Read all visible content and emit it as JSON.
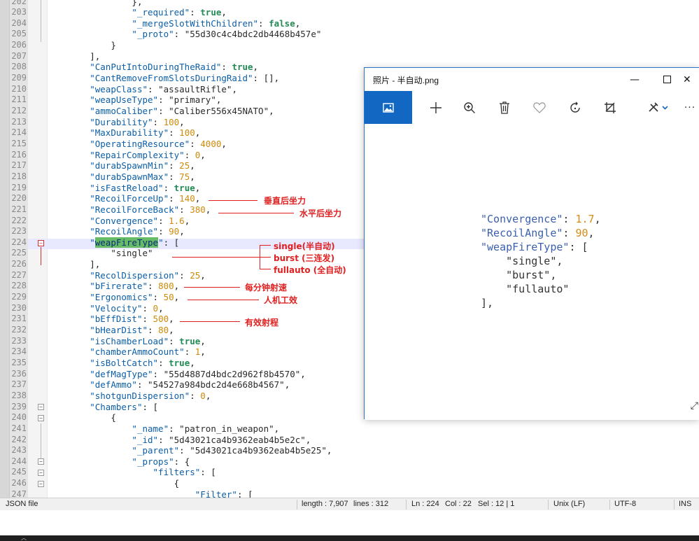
{
  "editor": {
    "lines": [
      {
        "no": "202",
        "html": "                <span class='p'>},</span>"
      },
      {
        "no": "203",
        "html": "                <span class='k'>\"_required\"</span><span class='p'>: </span><span class='b'>true</span><span class='p'>,</span>"
      },
      {
        "no": "204",
        "html": "                <span class='k'>\"_mergeSlotWithChildren\"</span><span class='p'>: </span><span class='b'>false</span><span class='p'>,</span>"
      },
      {
        "no": "205",
        "html": "                <span class='k'>\"_proto\"</span><span class='p'>: </span><span class='s'>\"55d30c4c4bdc2db4468b457e\"</span>"
      },
      {
        "no": "206",
        "html": "            <span class='p'>}</span>"
      },
      {
        "no": "207",
        "html": "        <span class='p'>],</span>"
      },
      {
        "no": "208",
        "html": "        <span class='k'>\"CanPutIntoDuringTheRaid\"</span><span class='p'>: </span><span class='b'>true</span><span class='p'>,</span>"
      },
      {
        "no": "209",
        "html": "        <span class='k'>\"CantRemoveFromSlotsDuringRaid\"</span><span class='p'>: [],</span>"
      },
      {
        "no": "210",
        "html": "        <span class='k'>\"weapClass\"</span><span class='p'>: </span><span class='s'>\"assaultRifle\"</span><span class='p'>,</span>"
      },
      {
        "no": "211",
        "html": "        <span class='k'>\"weapUseType\"</span><span class='p'>: </span><span class='s'>\"primary\"</span><span class='p'>,</span>"
      },
      {
        "no": "212",
        "html": "        <span class='k'>\"ammoCaliber\"</span><span class='p'>: </span><span class='s'>\"Caliber556x45NATO\"</span><span class='p'>,</span>"
      },
      {
        "no": "213",
        "html": "        <span class='k'>\"Durability\"</span><span class='p'>: </span><span class='n'>100</span><span class='p'>,</span>"
      },
      {
        "no": "214",
        "html": "        <span class='k'>\"MaxDurability\"</span><span class='p'>: </span><span class='n'>100</span><span class='p'>,</span>"
      },
      {
        "no": "215",
        "html": "        <span class='k'>\"OperatingResource\"</span><span class='p'>: </span><span class='n'>4000</span><span class='p'>,</span>"
      },
      {
        "no": "216",
        "html": "        <span class='k'>\"RepairComplexity\"</span><span class='p'>: </span><span class='n'>0</span><span class='p'>,</span>"
      },
      {
        "no": "217",
        "html": "        <span class='k'>\"durabSpawnMin\"</span><span class='p'>: </span><span class='n'>25</span><span class='p'>,</span>"
      },
      {
        "no": "218",
        "html": "        <span class='k'>\"durabSpawnMax\"</span><span class='p'>: </span><span class='n'>75</span><span class='p'>,</span>"
      },
      {
        "no": "219",
        "html": "        <span class='k'>\"isFastReload\"</span><span class='p'>: </span><span class='b'>true</span><span class='p'>,</span>"
      },
      {
        "no": "220",
        "html": "        <span class='k'>\"RecoilForceUp\"</span><span class='p'>: </span><span class='n'>140</span><span class='p'>,</span>"
      },
      {
        "no": "221",
        "html": "        <span class='k'>\"RecoilForceBack\"</span><span class='p'>: </span><span class='n'>380</span><span class='p'>,</span>"
      },
      {
        "no": "222",
        "html": "        <span class='k'>\"Convergence\"</span><span class='p'>: </span><span class='n'>1.6</span><span class='p'>,</span>"
      },
      {
        "no": "223",
        "html": "        <span class='k'>\"RecoilAngle\"</span><span class='p'>: </span><span class='n'>90</span><span class='p'>,</span>"
      },
      {
        "no": "224",
        "html": "        <span class='k'>\"</span><span class='sel'>weapFireType</span><span class='k'>\"</span><span class='p'>: [</span>"
      },
      {
        "no": "225",
        "html": "            <span class='s'>\"single\"</span>"
      },
      {
        "no": "226",
        "html": "        <span class='p'>],</span>"
      },
      {
        "no": "227",
        "html": "        <span class='k'>\"RecolDispersion\"</span><span class='p'>: </span><span class='n'>25</span><span class='p'>,</span>"
      },
      {
        "no": "228",
        "html": "        <span class='k'>\"bFirerate\"</span><span class='p'>: </span><span class='n'>800</span><span class='p'>,</span>"
      },
      {
        "no": "229",
        "html": "        <span class='k'>\"Ergonomics\"</span><span class='p'>: </span><span class='n'>50</span><span class='p'>,</span>"
      },
      {
        "no": "230",
        "html": "        <span class='k'>\"Velocity\"</span><span class='p'>: </span><span class='n'>0</span><span class='p'>,</span>"
      },
      {
        "no": "231",
        "html": "        <span class='k'>\"bEffDist\"</span><span class='p'>: </span><span class='n'>500</span><span class='p'>,</span>"
      },
      {
        "no": "232",
        "html": "        <span class='k'>\"bHearDist\"</span><span class='p'>: </span><span class='n'>80</span><span class='p'>,</span>"
      },
      {
        "no": "233",
        "html": "        <span class='k'>\"isChamberLoad\"</span><span class='p'>: </span><span class='b'>true</span><span class='p'>,</span>"
      },
      {
        "no": "234",
        "html": "        <span class='k'>\"chamberAmmoCount\"</span><span class='p'>: </span><span class='n'>1</span><span class='p'>,</span>"
      },
      {
        "no": "235",
        "html": "        <span class='k'>\"isBoltCatch\"</span><span class='p'>: </span><span class='b'>true</span><span class='p'>,</span>"
      },
      {
        "no": "236",
        "html": "        <span class='k'>\"defMagType\"</span><span class='p'>: </span><span class='s'>\"55d4887d4bdc2d962f8b4570\"</span><span class='p'>,</span>"
      },
      {
        "no": "237",
        "html": "        <span class='k'>\"defAmmo\"</span><span class='p'>: </span><span class='s'>\"54527a984bdc2d4e668b4567\"</span><span class='p'>,</span>"
      },
      {
        "no": "238",
        "html": "        <span class='k'>\"shotgunDispersion\"</span><span class='p'>: </span><span class='n'>0</span><span class='p'>,</span>"
      },
      {
        "no": "239",
        "html": "        <span class='k'>\"Chambers\"</span><span class='p'>: [</span>"
      },
      {
        "no": "240",
        "html": "            <span class='p'>{</span>"
      },
      {
        "no": "241",
        "html": "                <span class='k'>\"_name\"</span><span class='p'>: </span><span class='s'>\"patron_in_weapon\"</span><span class='p'>,</span>"
      },
      {
        "no": "242",
        "html": "                <span class='k'>\"_id\"</span><span class='p'>: </span><span class='s'>\"5d43021ca4b9362eab4b5e2c\"</span><span class='p'>,</span>"
      },
      {
        "no": "243",
        "html": "                <span class='k'>\"_parent\"</span><span class='p'>: </span><span class='s'>\"5d43021ca4b9362eab4b5e25\"</span><span class='p'>,</span>"
      },
      {
        "no": "244",
        "html": "                <span class='k'>\"_props\"</span><span class='p'>: {</span>"
      },
      {
        "no": "245",
        "html": "                    <span class='k'>\"filters\"</span><span class='p'>: [</span>"
      },
      {
        "no": "246",
        "html": "                        <span class='p'>{</span>"
      },
      {
        "no": "247",
        "html": "                            <span class='k'>\"Filter\"</span><span class='p'>: [</span>"
      }
    ],
    "selected_line": "224",
    "selected_word": "weapFireType"
  },
  "annotations": {
    "recoil_up": "垂直后坐力",
    "recoil_back": "水平后坐力",
    "single": "single(半自动)",
    "burst": "burst (三连发)",
    "fullauto": "fullauto (全自动)",
    "firerate": "每分钟射速",
    "ergonomics": "人机工效",
    "eff_dist": "有效射程"
  },
  "statusbar": {
    "file_type": "JSON file",
    "length": "length : 7,907",
    "lines": "lines : 312",
    "ln": "Ln : 224",
    "col": "Col : 22",
    "sel": "Sel : 12 | 1",
    "eol": "Unix (LF)",
    "encoding": "UTF-8",
    "mode": "INS"
  },
  "photos": {
    "title": "照片 - 半自动.png",
    "minimize": "—",
    "maximize": "☐",
    "close": "✕",
    "tools": [
      "image-icon",
      "add-icon",
      "zoom-in-icon",
      "delete-icon",
      "favorite-icon",
      "rotate-icon",
      "crop-icon",
      "edit-icon",
      "more-icon"
    ],
    "image_lines": [
      {
        "html": "<span class='ik'>\"Convergence\"</span><span class='is'>: </span><span class='in'>1.7</span><span class='is'>,</span>"
      },
      {
        "html": "<span class='ik'>\"RecoilAngle\"</span><span class='is'>: </span><span class='in'>90</span><span class='is'>,</span>"
      },
      {
        "html": "<span class='ik'>\"weapFireType\"</span><span class='is'>: [</span>"
      },
      {
        "html": "    <span class='is'>\"single\",</span>"
      },
      {
        "html": "    <span class='is'>\"burst\",</span>"
      },
      {
        "html": "    <span class='is'>\"fullauto\"</span>"
      },
      {
        "html": "<span class='is'>],</span>"
      }
    ]
  },
  "colors": {
    "accent": "#1167c2",
    "annotation": "#e02020",
    "selection": "#66bb66"
  }
}
